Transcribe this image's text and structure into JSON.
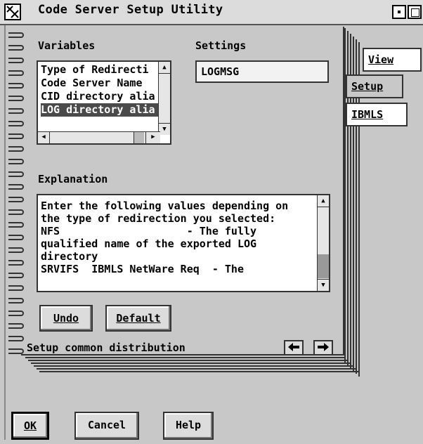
{
  "window": {
    "title": "Code Server Setup Utility"
  },
  "notebook": {
    "variables_label": "Variables",
    "settings_label": "Settings",
    "variables_list": [
      "Type of Redirecti",
      "Code Server Name",
      "CID directory alia",
      "LOG directory alia"
    ],
    "selected_index": 3,
    "settings_value": "LOGMSG",
    "explanation_label": "Explanation",
    "explanation_lines": [
      "Enter the following values depending on",
      "the type of redirection you selected:",
      "NFS                    - The fully",
      "qualified name of the exported LOG",
      "directory",
      "SRVIFS  IBMLS NetWare Req  - The"
    ],
    "undo_label": "Undo",
    "default_label": "Default",
    "status_text": "Setup common distribution"
  },
  "tabs": {
    "view": "View",
    "setup": "Setup",
    "ibmls": "IBMLS"
  },
  "buttons": {
    "ok": "OK",
    "cancel": "Cancel",
    "help": "Help"
  },
  "icons": [
    "window-icon",
    "minimize-icon",
    "maximize-icon",
    "scroll-up-icon",
    "scroll-down-icon",
    "scroll-left-icon",
    "scroll-right-icon",
    "page-back-icon",
    "page-forward-icon"
  ]
}
